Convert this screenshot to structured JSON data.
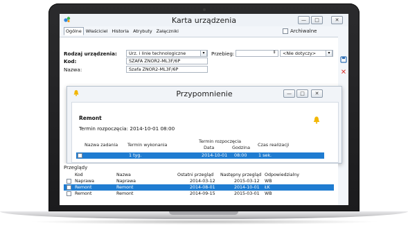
{
  "window": {
    "title": "Karta urządzenia",
    "tabs": [
      "Ogólne",
      "Właściciel",
      "Historia",
      "Atrybuty",
      "Załączniki"
    ],
    "archive_label": "Archiwalne",
    "minimize": "—",
    "maximize": "□",
    "close": "✕"
  },
  "form": {
    "rodzaj_label": "Rodzaj urządzenia:",
    "rodzaj_value": "Urz. i linie technologiczne",
    "przebieg_label": "Przebieg:",
    "przebieg_value": "",
    "przebieg_unit": "<Nie dotyczy>",
    "kod_label": "Kod:",
    "kod_value": "SZAFA ZNOR2-ML3F/6P",
    "nazwa_label": "Nazwa:",
    "nazwa_value": "Szafa ZNOR2-ML3F/6P"
  },
  "dialog": {
    "title": "Przypomnienie",
    "heading": "Remont",
    "termin_label": "Termin rozpoczęcia: 2014-10-01 08:00",
    "columns": {
      "nazwa": "Nazwa zadania",
      "termin_wyk": "Termin wykonania",
      "termin_roz": "Termin rozpoczęcia",
      "data": "Data",
      "godzina": "Godzina",
      "czas": "Czas realizacji"
    },
    "row": {
      "termin_wyk": "1 tyg.",
      "data": "2014-10-01",
      "godzina": "08:00",
      "czas": "1 sek."
    }
  },
  "przeglady": {
    "title": "Przeglądy",
    "columns": [
      "Kod",
      "Nazwa",
      "Ostatni przegląd",
      "Następny przegląd",
      "Odpowiedzialny"
    ],
    "rows": [
      {
        "kod": "Naprawa",
        "nazwa": "Naprawa",
        "ostatni": "2014-03-12",
        "nastepny": "2015-03-12",
        "odp": "WB",
        "selected": false
      },
      {
        "kod": "Remont",
        "nazwa": "Remont",
        "ostatni": "2014-08-01",
        "nastepny": "2014-10-01",
        "odp": "ŁK",
        "selected": true
      },
      {
        "kod": "Remont",
        "nazwa": "Remont",
        "ostatni": "2014-09-15",
        "nastepny": "2015-03-01",
        "odp": "WB",
        "selected": false
      }
    ]
  },
  "colors": {
    "selection": "#1f7cd1",
    "bell": "#f2b705"
  },
  "icons": {
    "save": "save-icon",
    "delete": "delete-icon"
  }
}
